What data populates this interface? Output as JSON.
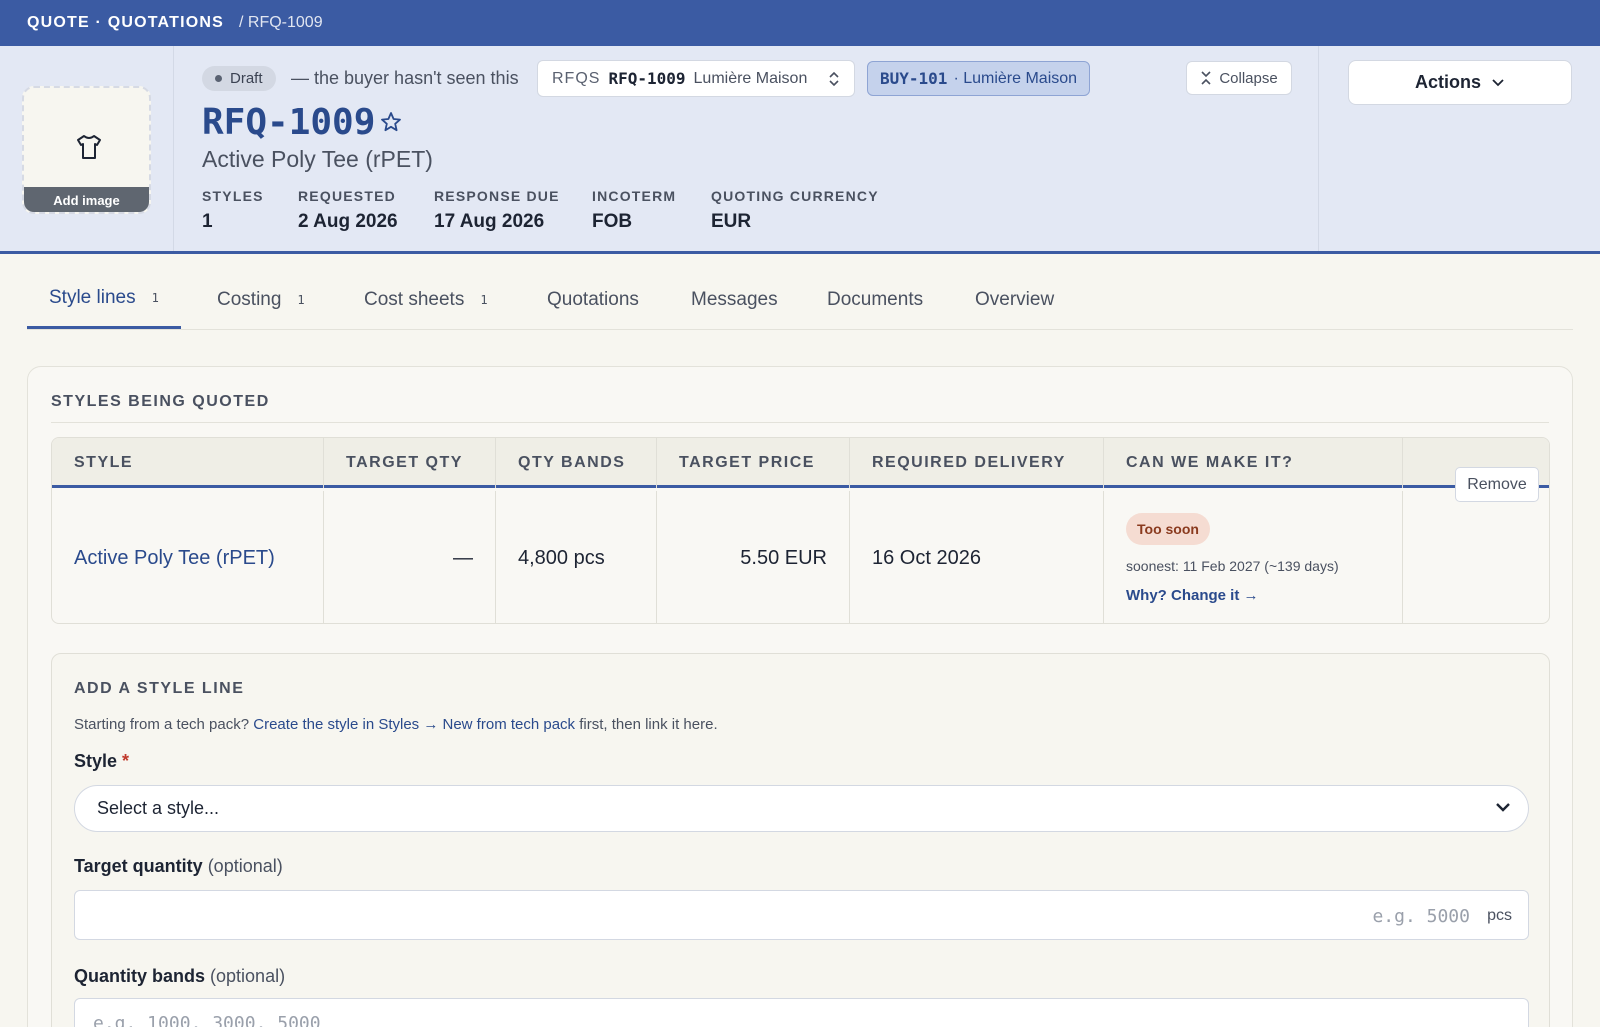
{
  "topbar": {
    "app": "QUOTE · QUOTATIONS",
    "crumb": "/ RFQ-1009"
  },
  "header": {
    "add_image": "Add image",
    "status": "Draft",
    "status_note": "— the buyer hasn't seen this",
    "rfq_picker": {
      "label": "RFQS",
      "code": "RFQ-1009",
      "client": "Lumière Maison"
    },
    "buyer_chip": {
      "code": "BUY-101",
      "name": "· Lumière Maison"
    },
    "collapse": "Collapse",
    "actions": "Actions",
    "title": "RFQ-1009",
    "subtitle": "Active Poly Tee (rPET)",
    "meta": [
      {
        "key": "STYLES",
        "value": "1"
      },
      {
        "key": "REQUESTED",
        "value": "2 Aug 2026"
      },
      {
        "key": "RESPONSE DUE",
        "value": "17 Aug 2026"
      },
      {
        "key": "INCOTERM",
        "value": "FOB"
      },
      {
        "key": "QUOTING CURRENCY",
        "value": "EUR"
      }
    ]
  },
  "tabs": [
    {
      "label": "Style lines",
      "count": "1"
    },
    {
      "label": "Costing",
      "count": "1"
    },
    {
      "label": "Cost sheets",
      "count": "1"
    },
    {
      "label": "Quotations"
    },
    {
      "label": "Messages"
    },
    {
      "label": "Documents"
    },
    {
      "label": "Overview"
    }
  ],
  "styles_section": {
    "title": "STYLES BEING QUOTED",
    "columns": [
      "STYLE",
      "TARGET QTY",
      "QTY BANDS",
      "TARGET PRICE",
      "REQUIRED DELIVERY",
      "CAN WE MAKE IT?"
    ],
    "rows": [
      {
        "style": "Active Poly Tee (rPET)",
        "target_qty": "—",
        "qty_bands": "4,800 pcs",
        "target_price": "5.50 EUR",
        "required_delivery": "16 Oct 2026",
        "feasibility": {
          "badge": "Too soon",
          "soonest": "soonest: 11 Feb 2027 (~139 days)",
          "link": "Why? Change it →"
        },
        "remove": "Remove"
      }
    ]
  },
  "add_line": {
    "title": "ADD A STYLE LINE",
    "hint_prefix": "Starting from a tech pack?",
    "hint_link": "Create the style in Styles → New from tech pack",
    "hint_suffix": "first, then link it here.",
    "style_label": "Style",
    "required_mark": "*",
    "style_placeholder": "Select a style...",
    "target_qty_label": "Target quantity",
    "optional": "(optional)",
    "target_qty_placeholder": "e.g. 5000",
    "target_qty_unit": "pcs",
    "bands_label": "Quantity bands",
    "bands_placeholder": "e.g. 1000, 3000, 5000"
  },
  "colors": {
    "brand": "#3b5ba3",
    "link": "#2a4a8c",
    "warn_bg": "#f5dcd2",
    "warn_fg": "#8a3a1e"
  }
}
